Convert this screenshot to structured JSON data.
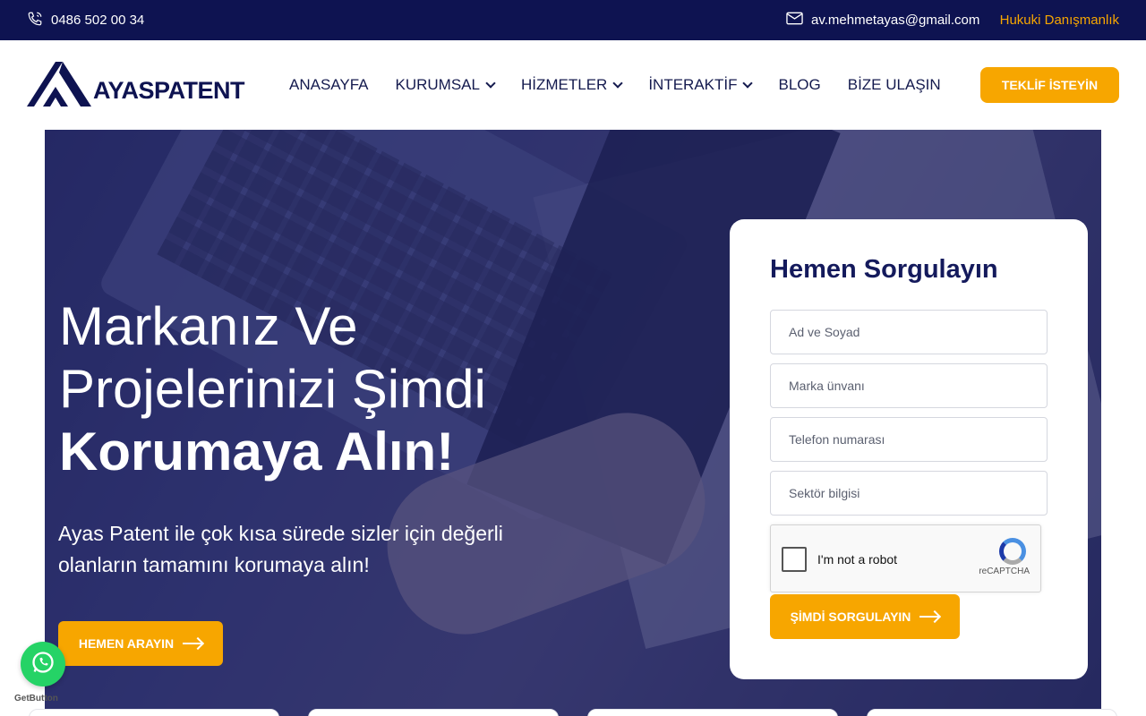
{
  "topbar": {
    "phone": "0486 502 00 34",
    "email": "av.mehmetayas@gmail.com",
    "legal_link": "Hukuki Danışmanlık"
  },
  "header": {
    "logo_text": "AYASPATENT",
    "nav": [
      {
        "label": "ANASAYFA",
        "dropdown": false
      },
      {
        "label": "KURUMSAL",
        "dropdown": true
      },
      {
        "label": "HİZMETLER",
        "dropdown": true
      },
      {
        "label": "İNTERAKTİF",
        "dropdown": true
      },
      {
        "label": "BLOG",
        "dropdown": false
      },
      {
        "label": "BİZE ULAŞIN",
        "dropdown": false
      }
    ],
    "cta_label": "TEKLİF İSTEYİN"
  },
  "hero": {
    "title_line1": "Markanız Ve",
    "title_line2": "Projelerinizi Şimdi",
    "title_line3": "Korumaya Alın!",
    "subtitle": "Ayas Patent ile çok kısa sürede sizler için değerli olanların tamamını korumaya alın!",
    "button_label": "HEMEN ARAYIN"
  },
  "form": {
    "title": "Hemen Sorgulayın",
    "fields": {
      "name_placeholder": "Ad ve Soyad",
      "brand_placeholder": "Marka ünvanı",
      "phone_placeholder": "Telefon numarası",
      "sector_placeholder": "Sektör bilgisi"
    },
    "recaptcha_label": "I'm not a robot",
    "recaptcha_brand": "reCAPTCHA",
    "submit_label": "ŞİMDİ SORGULAYIN"
  },
  "widgets": {
    "getbutton_label": "GetButton"
  },
  "colors": {
    "navy": "#0e1351",
    "accent": "#f7a600",
    "whatsapp": "#25d366"
  }
}
